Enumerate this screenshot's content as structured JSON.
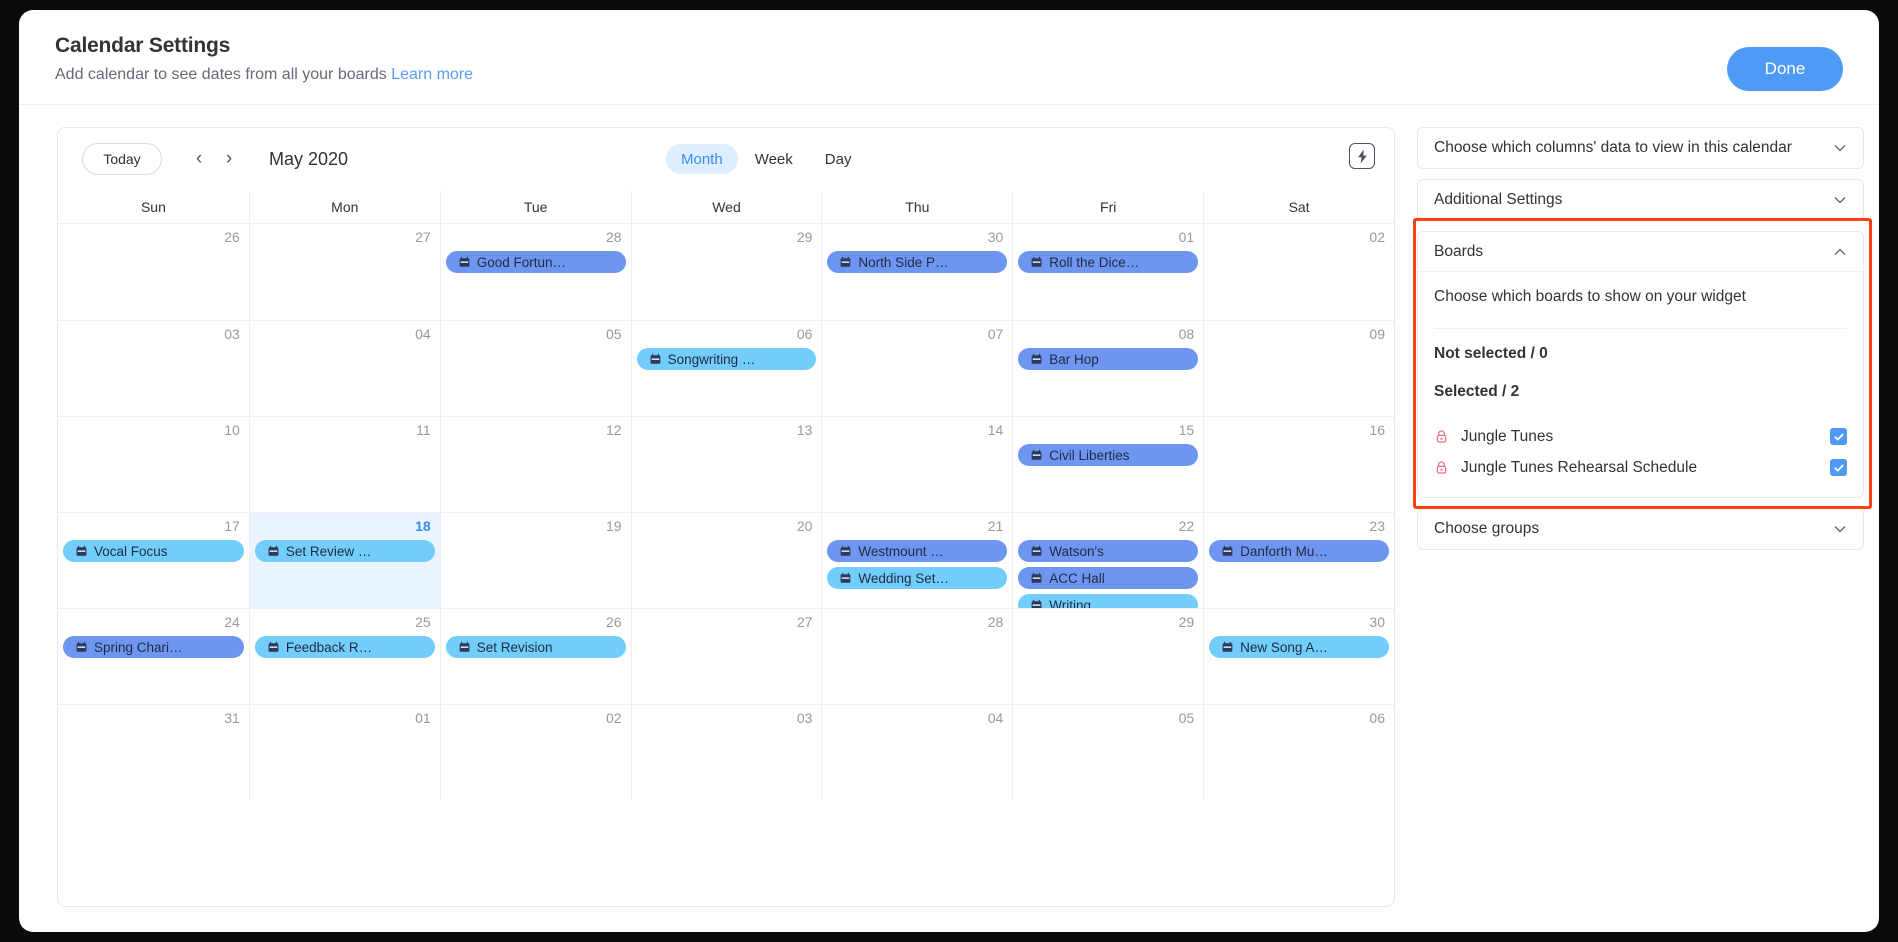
{
  "dialog": {
    "title": "Calendar Settings",
    "subtitle": "Add calendar to see dates from all your boards",
    "learn_more": "Learn more",
    "done_label": "Done"
  },
  "calendar": {
    "today_label": "Today",
    "prev_icon": "chevron-left-icon",
    "next_icon": "chevron-right-icon",
    "current_period": "May 2020",
    "views": [
      {
        "label": "Month",
        "active": true
      },
      {
        "label": "Week",
        "active": false
      },
      {
        "label": "Day",
        "active": false
      }
    ],
    "zap_icon": "lightning-bolt-icon",
    "weekdays": [
      "Sun",
      "Mon",
      "Tue",
      "Wed",
      "Thu",
      "Fri",
      "Sat"
    ],
    "today_date": "18",
    "accent_blue": "#4f9af5",
    "event_colors": {
      "blue": "#6e96f0",
      "cyan": "#72cdfa"
    },
    "days": [
      {
        "n": "26",
        "muted": true,
        "events": []
      },
      {
        "n": "27",
        "muted": true,
        "events": []
      },
      {
        "n": "28",
        "muted": true,
        "events": [
          {
            "label": "Good Fortun…",
            "color": "blue"
          }
        ]
      },
      {
        "n": "29",
        "muted": true,
        "events": []
      },
      {
        "n": "30",
        "muted": true,
        "events": [
          {
            "label": "North Side P…",
            "color": "blue"
          }
        ]
      },
      {
        "n": "01",
        "muted": false,
        "events": [
          {
            "label": "Roll the Dice…",
            "color": "blue"
          }
        ]
      },
      {
        "n": "02",
        "muted": false,
        "events": []
      },
      {
        "n": "03",
        "muted": false,
        "events": []
      },
      {
        "n": "04",
        "muted": false,
        "events": []
      },
      {
        "n": "05",
        "muted": false,
        "events": []
      },
      {
        "n": "06",
        "muted": false,
        "events": [
          {
            "label": "Songwriting …",
            "color": "cyan"
          }
        ]
      },
      {
        "n": "07",
        "muted": false,
        "events": []
      },
      {
        "n": "08",
        "muted": false,
        "events": [
          {
            "label": "Bar Hop",
            "color": "blue"
          }
        ]
      },
      {
        "n": "09",
        "muted": false,
        "events": []
      },
      {
        "n": "10",
        "muted": false,
        "events": []
      },
      {
        "n": "11",
        "muted": false,
        "events": []
      },
      {
        "n": "12",
        "muted": false,
        "events": []
      },
      {
        "n": "13",
        "muted": false,
        "events": []
      },
      {
        "n": "14",
        "muted": false,
        "events": []
      },
      {
        "n": "15",
        "muted": false,
        "events": [
          {
            "label": "Civil Liberties",
            "color": "blue"
          }
        ]
      },
      {
        "n": "16",
        "muted": false,
        "events": []
      },
      {
        "n": "17",
        "muted": false,
        "events": [
          {
            "label": "Vocal Focus",
            "color": "cyan"
          }
        ]
      },
      {
        "n": "18",
        "muted": false,
        "today": true,
        "events": [
          {
            "label": "Set Review …",
            "color": "cyan"
          }
        ]
      },
      {
        "n": "19",
        "muted": false,
        "events": []
      },
      {
        "n": "20",
        "muted": false,
        "events": []
      },
      {
        "n": "21",
        "muted": false,
        "events": [
          {
            "label": "Westmount …",
            "color": "blue"
          },
          {
            "label": "Wedding Set…",
            "color": "cyan"
          }
        ]
      },
      {
        "n": "22",
        "muted": false,
        "events": [
          {
            "label": "Watson's",
            "color": "blue"
          },
          {
            "label": "ACC Hall",
            "color": "blue"
          },
          {
            "label": "Writing",
            "color": "cyan"
          }
        ]
      },
      {
        "n": "23",
        "muted": false,
        "events": [
          {
            "label": "Danforth Mu…",
            "color": "blue"
          }
        ]
      },
      {
        "n": "24",
        "muted": false,
        "events": [
          {
            "label": "Spring Chari…",
            "color": "blue"
          }
        ]
      },
      {
        "n": "25",
        "muted": false,
        "events": [
          {
            "label": "Feedback R…",
            "color": "cyan"
          }
        ]
      },
      {
        "n": "26",
        "muted": false,
        "events": [
          {
            "label": "Set Revision",
            "color": "cyan"
          }
        ]
      },
      {
        "n": "27",
        "muted": false,
        "events": []
      },
      {
        "n": "28",
        "muted": false,
        "events": []
      },
      {
        "n": "29",
        "muted": false,
        "events": []
      },
      {
        "n": "30",
        "muted": false,
        "events": [
          {
            "label": "New Song A…",
            "color": "cyan"
          }
        ]
      },
      {
        "n": "31",
        "muted": false,
        "events": []
      },
      {
        "n": "01",
        "muted": true,
        "events": []
      },
      {
        "n": "02",
        "muted": true,
        "events": []
      },
      {
        "n": "03",
        "muted": true,
        "events": []
      },
      {
        "n": "04",
        "muted": true,
        "events": []
      },
      {
        "n": "05",
        "muted": true,
        "events": []
      },
      {
        "n": "06",
        "muted": true,
        "events": []
      }
    ]
  },
  "settings": {
    "columns_accordion": {
      "label": "Choose which columns' data to view in this calendar",
      "expanded": false
    },
    "additional_accordion": {
      "label": "Additional Settings",
      "expanded": false
    },
    "boards_accordion": {
      "label": "Boards",
      "expanded": true,
      "hint": "Choose which boards to show on your widget",
      "not_selected_title": "Not selected / 0",
      "selected_title": "Selected / 2",
      "highlight_color": "#fa3f10",
      "boards": [
        {
          "name": "Jungle Tunes",
          "checked": true,
          "icon": "lock-icon"
        },
        {
          "name": "Jungle Tunes Rehearsal Schedule",
          "checked": true,
          "icon": "lock-icon"
        }
      ]
    },
    "groups_accordion": {
      "label": "Choose groups",
      "expanded": false
    }
  }
}
